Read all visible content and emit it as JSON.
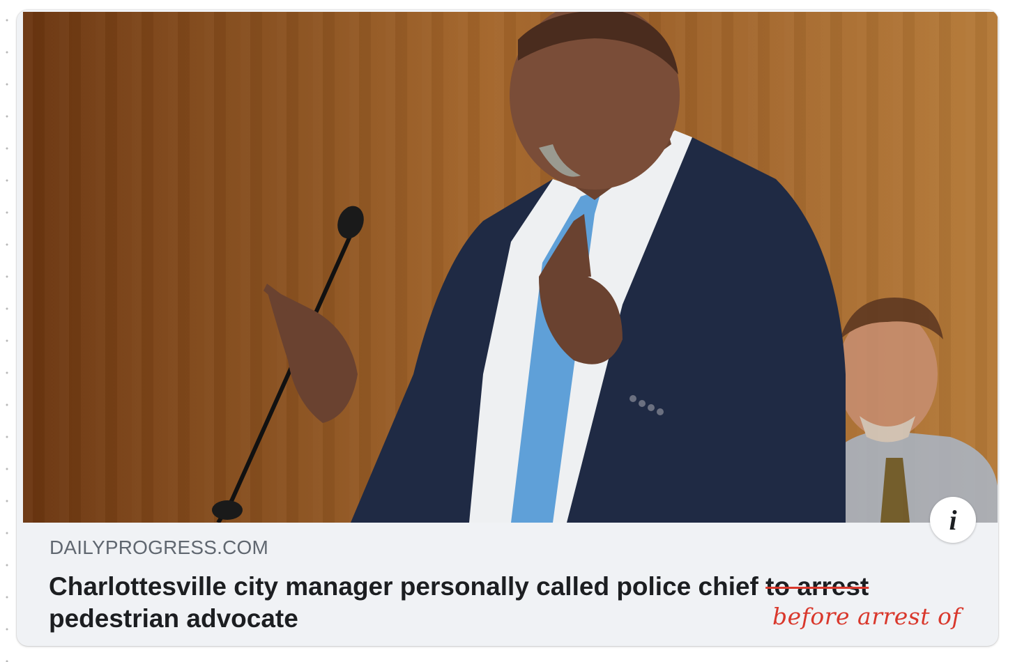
{
  "link_preview": {
    "domain": "DAILYPROGRESS.COM",
    "headline_start": "Charlottesville city manager personally called police chief ",
    "headline_struck": "to arrest",
    "headline_end": "pedestrian advocate",
    "handwritten_correction": "before arrest of",
    "info_icon": "info-icon",
    "colors": {
      "card_background": "#f0f2f5",
      "domain_text": "#606770",
      "headline_text": "#1c1e21",
      "correction_red": "#d9382c"
    }
  }
}
